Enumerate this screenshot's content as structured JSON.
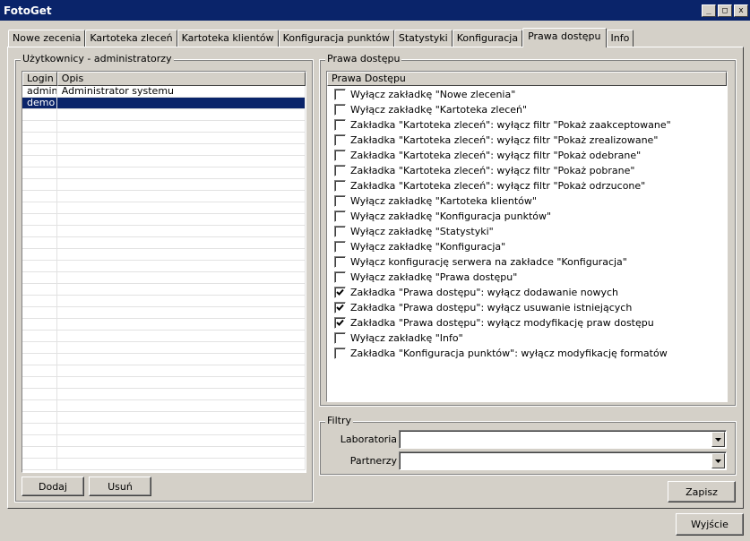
{
  "window": {
    "title": "FotoGet",
    "minimize": "_",
    "maximize": "□",
    "close": "x"
  },
  "tabs": [
    {
      "label": "Nowe zecenia",
      "active": false
    },
    {
      "label": "Kartoteka zleceń",
      "active": false
    },
    {
      "label": "Kartoteka klientów",
      "active": false
    },
    {
      "label": "Konfiguracja punktów",
      "active": false
    },
    {
      "label": "Statystyki",
      "active": false
    },
    {
      "label": "Konfiguracja",
      "active": false
    },
    {
      "label": "Prawa dostępu",
      "active": true
    },
    {
      "label": "Info",
      "active": false
    }
  ],
  "users": {
    "group_title": "Użytkownicy - administratorzy",
    "columns": [
      "Login",
      "Opis"
    ],
    "rows": [
      {
        "login": "admin",
        "description": "Administrator systemu",
        "selected": false
      },
      {
        "login": "demo",
        "description": "",
        "selected": true
      }
    ],
    "add_label": "Dodaj",
    "remove_label": "Usuń"
  },
  "permissions": {
    "group_title": "Prawa dostępu",
    "column_header": "Prawa Dostępu",
    "items": [
      {
        "label": "Wyłącz zakładkę \"Nowe zlecenia\"",
        "checked": false
      },
      {
        "label": "Wyłącz zakładkę \"Kartoteka zleceń\"",
        "checked": false
      },
      {
        "label": "Zakładka \"Kartoteka zleceń\": wyłącz filtr \"Pokaż zaakceptowane\"",
        "checked": false
      },
      {
        "label": "Zakładka \"Kartoteka zleceń\": wyłącz filtr \"Pokaż zrealizowane\"",
        "checked": false
      },
      {
        "label": "Zakładka \"Kartoteka zleceń\": wyłącz filtr \"Pokaż odebrane\"",
        "checked": false
      },
      {
        "label": "Zakładka \"Kartoteka zleceń\": wyłącz filtr \"Pokaż pobrane\"",
        "checked": false
      },
      {
        "label": "Zakładka \"Kartoteka zleceń\": wyłącz filtr \"Pokaż odrzucone\"",
        "checked": false
      },
      {
        "label": "Wyłącz zakładkę \"Kartoteka klientów\"",
        "checked": false
      },
      {
        "label": "Wyłącz zakładkę \"Konfiguracja punktów\"",
        "checked": false
      },
      {
        "label": "Wyłącz zakładkę \"Statystyki\"",
        "checked": false
      },
      {
        "label": "Wyłącz zakładkę \"Konfiguracja\"",
        "checked": false
      },
      {
        "label": "Wyłącz konfigurację serwera na zakładce \"Konfiguracja\"",
        "checked": false
      },
      {
        "label": "Wyłącz zakładkę \"Prawa dostępu\"",
        "checked": false
      },
      {
        "label": "Zakładka \"Prawa dostępu\": wyłącz dodawanie nowych",
        "checked": true
      },
      {
        "label": "Zakładka \"Prawa dostępu\": wyłącz usuwanie istniejących",
        "checked": true
      },
      {
        "label": "Zakładka \"Prawa dostępu\": wyłącz modyfikację praw dostępu",
        "checked": true
      },
      {
        "label": "Wyłącz zakładkę \"Info\"",
        "checked": false
      },
      {
        "label": "Zakładka \"Konfiguracja punktów\": wyłącz modyfikację formatów",
        "checked": false
      }
    ]
  },
  "filters": {
    "group_title": "Filtry",
    "laboratory_label": "Laboratoria",
    "laboratory_value": "",
    "partners_label": "Partnerzy",
    "partners_value": ""
  },
  "buttons": {
    "save_label": "Zapisz",
    "exit_label": "Wyjście"
  },
  "colors": {
    "titlebar": "#0a246a",
    "selection": "#0a246a",
    "face": "#d4d0c8"
  },
  "icons": {
    "combo_arrow": "dropdown-arrow-icon",
    "check": "checkmark-icon"
  }
}
